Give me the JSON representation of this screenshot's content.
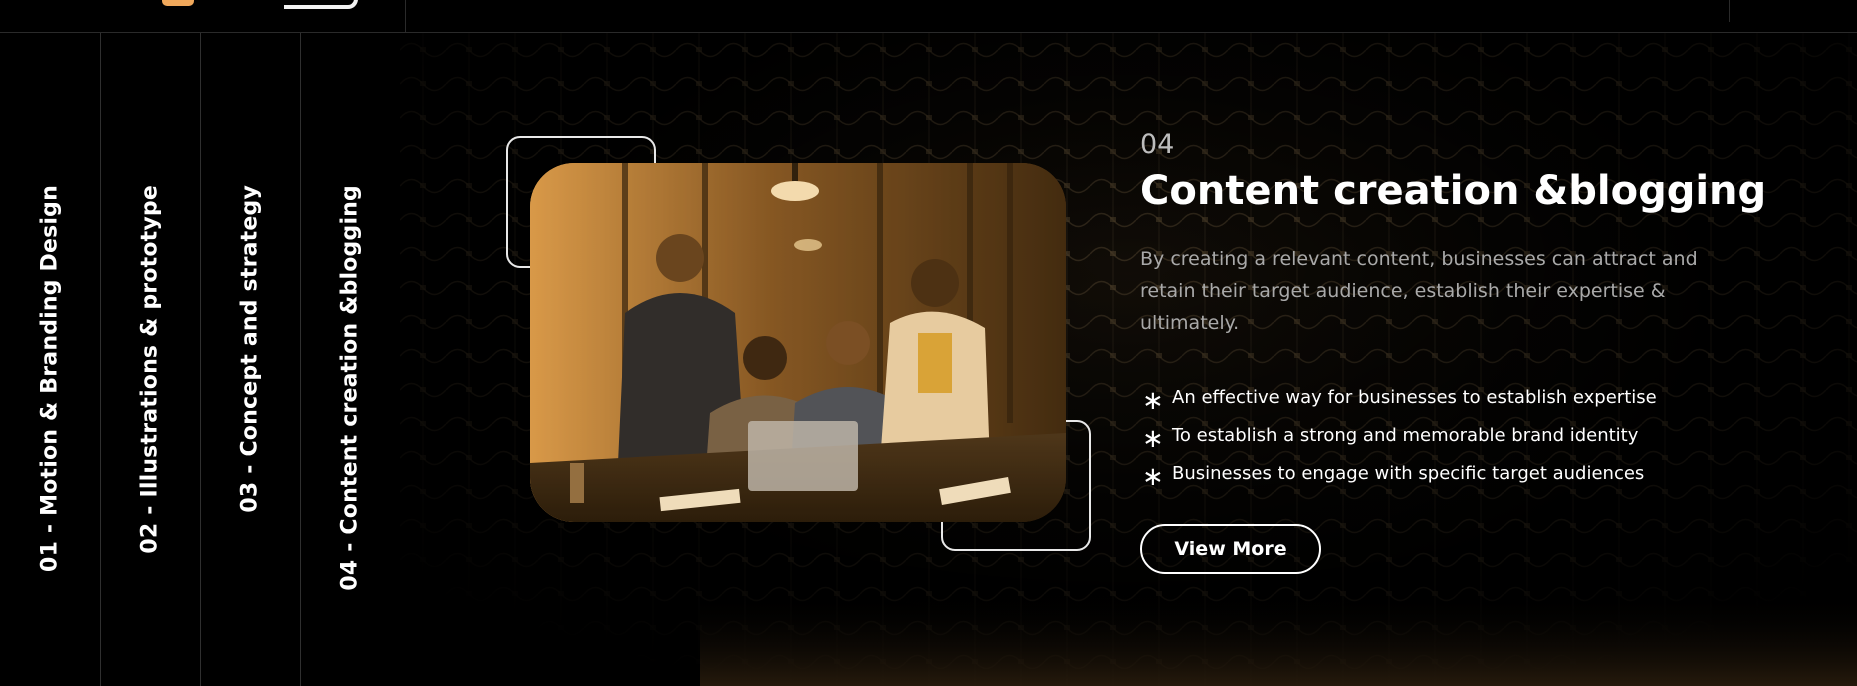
{
  "tabs": [
    {
      "label": "01 - Motion & Branding Design"
    },
    {
      "label": "02 - Illustrations & prototype"
    },
    {
      "label": "03 - Concept and strategy"
    },
    {
      "label": "04 - Content creation &blogging"
    }
  ],
  "content": {
    "number": "04",
    "title": "Content creation &blogging",
    "description": "By creating a relevant content, businesses can attract and retain their target audience, establish their expertise & ultimately.",
    "bullets": [
      "An effective way for businesses to establish expertise",
      "To establish a strong and memorable brand identity",
      "Businesses to engage with specific target audiences"
    ],
    "bullet_icon": "asterisk-icon",
    "button_label": "View More"
  },
  "colors": {
    "background": "#000000",
    "accent": "#f0a85b",
    "text": "#ffffff",
    "muted": "#a9a9a9"
  }
}
